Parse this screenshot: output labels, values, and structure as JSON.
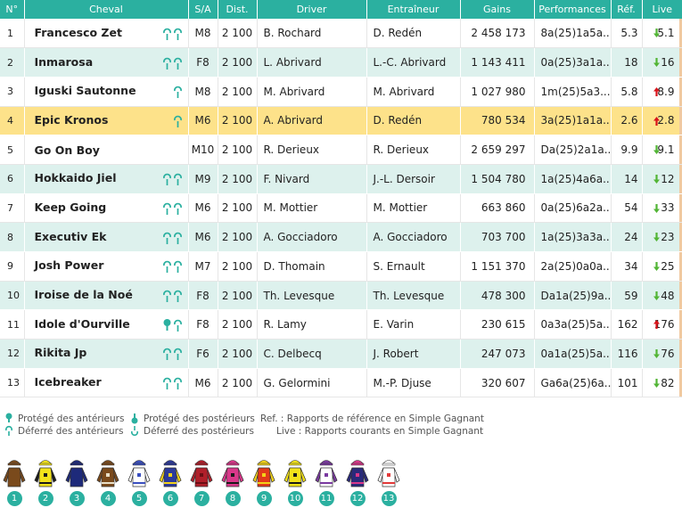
{
  "colors": {
    "accent": "#2bb0a0",
    "row_alt": "#ddf1ed",
    "row_selected": "#fde28a",
    "arrow_down": "#52b535",
    "arrow_up": "#d9131a"
  },
  "headers": {
    "num": "N°",
    "cheval": "Cheval",
    "sa": "S/A",
    "dist": "Dist.",
    "driver": "Driver",
    "entraineur": "Entraîneur",
    "gains": "Gains",
    "performances": "Performances",
    "ref": "Réf.",
    "live": "Live"
  },
  "rows": [
    {
      "num": "1",
      "cheval": "Francesco Zet",
      "shoes": [
        "deferre",
        "deferre"
      ],
      "sa": "M8",
      "dist": "2 100",
      "driver": "B. Rochard",
      "entraineur": "D. Redén",
      "gains": "2 458 173",
      "perf": "8a(25)1a5a...",
      "ref": "5.3",
      "live": "5.1",
      "trend": "down"
    },
    {
      "num": "2",
      "cheval": "Inmarosa",
      "shoes": [
        "deferre",
        "deferre"
      ],
      "sa": "F8",
      "dist": "2 100",
      "driver": "L. Abrivard",
      "entraineur": "L.-C. Abrivard",
      "gains": "1 143 411",
      "perf": "0a(25)3a1a...",
      "ref": "18",
      "live": "16",
      "trend": "down"
    },
    {
      "num": "3",
      "cheval": "Iguski Sautonne",
      "shoes": [
        "deferre"
      ],
      "sa": "M8",
      "dist": "2 100",
      "driver": "M. Abrivard",
      "entraineur": "M. Abrivard",
      "gains": "1 027 980",
      "perf": "1m(25)5a3...",
      "ref": "5.8",
      "live": "8.9",
      "trend": "up"
    },
    {
      "num": "4",
      "cheval": "Epic Kronos",
      "shoes": [
        "deferre"
      ],
      "sa": "M6",
      "dist": "2 100",
      "driver": "A. Abrivard",
      "entraineur": "D. Redén",
      "gains": "780 534",
      "perf": "3a(25)1a1a...",
      "ref": "2.6",
      "live": "2.8",
      "trend": "up"
    },
    {
      "num": "5",
      "cheval": "Go On Boy",
      "shoes": [],
      "sa": "M10",
      "dist": "2 100",
      "driver": "R. Derieux",
      "entraineur": "R. Derieux",
      "gains": "2 659 297",
      "perf": "Da(25)2a1a...",
      "ref": "9.9",
      "live": "9.1",
      "trend": "down"
    },
    {
      "num": "6",
      "cheval": "Hokkaido Jiel",
      "shoes": [
        "deferre",
        "deferre"
      ],
      "sa": "M9",
      "dist": "2 100",
      "driver": "F. Nivard",
      "entraineur": "J.-L. Dersoir",
      "gains": "1 504 780",
      "perf": "1a(25)4a6a...",
      "ref": "14",
      "live": "12",
      "trend": "down"
    },
    {
      "num": "7",
      "cheval": "Keep Going",
      "shoes": [
        "deferre",
        "deferre"
      ],
      "sa": "M6",
      "dist": "2 100",
      "driver": "M. Mottier",
      "entraineur": "M. Mottier",
      "gains": "663 860",
      "perf": "0a(25)6a2a...",
      "ref": "54",
      "live": "33",
      "trend": "down"
    },
    {
      "num": "8",
      "cheval": "Executiv Ek",
      "shoes": [
        "deferre",
        "deferre"
      ],
      "sa": "M6",
      "dist": "2 100",
      "driver": "A. Gocciadoro",
      "entraineur": "A. Gocciadoro",
      "gains": "703 700",
      "perf": "1a(25)3a3a...",
      "ref": "24",
      "live": "23",
      "trend": "down"
    },
    {
      "num": "9",
      "cheval": "Josh Power",
      "shoes": [
        "deferre",
        "deferre"
      ],
      "sa": "M7",
      "dist": "2 100",
      "driver": "D. Thomain",
      "entraineur": "S. Ernault",
      "gains": "1 151 370",
      "perf": "2a(25)0a0a...",
      "ref": "34",
      "live": "25",
      "trend": "down"
    },
    {
      "num": "10",
      "cheval": "Iroise de la Noé",
      "shoes": [
        "deferre",
        "deferre"
      ],
      "sa": "F8",
      "dist": "2 100",
      "driver": "Th. Levesque",
      "entraineur": "Th. Levesque",
      "gains": "478 300",
      "perf": "Da1a(25)9a...",
      "ref": "59",
      "live": "48",
      "trend": "down"
    },
    {
      "num": "11",
      "cheval": "Idole d'Ourville",
      "shoes": [
        "protege",
        "deferre"
      ],
      "sa": "F8",
      "dist": "2 100",
      "driver": "R. Lamy",
      "entraineur": "E. Varin",
      "gains": "230 615",
      "perf": "0a3a(25)5a...",
      "ref": "162",
      "live": "176",
      "trend": "up"
    },
    {
      "num": "12",
      "cheval": "Rikita Jp",
      "shoes": [
        "deferre",
        "deferre"
      ],
      "sa": "F6",
      "dist": "2 100",
      "driver": "C. Delbecq",
      "entraineur": "J. Robert",
      "gains": "247 073",
      "perf": "0a1a(25)5a...",
      "ref": "116",
      "live": "76",
      "trend": "down"
    },
    {
      "num": "13",
      "cheval": "Icebreaker",
      "shoes": [
        "deferre",
        "deferre"
      ],
      "sa": "M6",
      "dist": "2 100",
      "driver": "G. Gelormini",
      "entraineur": "M.-P. Djuse",
      "gains": "320 607",
      "perf": "Ga6a(25)6a...",
      "ref": "101",
      "live": "82",
      "trend": "down"
    }
  ],
  "legend": {
    "protege_ant": "Protégé des antérieurs",
    "deferre_ant": "Déferré des antérieurs",
    "protege_post": "Protégé des postérieurs",
    "deferre_post": "Déferré des postérieurs",
    "ref_note": "Ref. : Rapports de référence en Simple Gagnant",
    "live_note": "Live : Rapports courants en Simple Gagnant"
  },
  "casaques": [
    {
      "num": "1",
      "body": "#7a4a1c",
      "sleeve": "#7a4a1c",
      "cap": "#7a4a1c",
      "accent": "#7a4a1c"
    },
    {
      "num": "2",
      "body": "#f2e21a",
      "sleeve": "#1a1a1a",
      "cap": "#f2e21a",
      "accent": "#1a1a1a"
    },
    {
      "num": "3",
      "body": "#1e2a7a",
      "sleeve": "#1e2a7a",
      "cap": "#1e2a7a",
      "accent": "#1e2a7a"
    },
    {
      "num": "4",
      "body": "#7a4a1c",
      "sleeve": "#7a4a1c",
      "cap": "#7a4a1c",
      "accent": "#e9e0c8"
    },
    {
      "num": "5",
      "body": "#ffffff",
      "sleeve": "#ffffff",
      "cap": "#3a4fbf",
      "accent": "#3a4fbf"
    },
    {
      "num": "6",
      "body": "#2c3a9a",
      "sleeve": "#f2d21a",
      "cap": "#2c3a9a",
      "accent": "#f2d21a"
    },
    {
      "num": "7",
      "body": "#b01f2a",
      "sleeve": "#b01f2a",
      "cap": "#b01f2a",
      "accent": "#6a0f15"
    },
    {
      "num": "8",
      "body": "#d9388a",
      "sleeve": "#d9388a",
      "cap": "#d9388a",
      "accent": "#1a1a1a"
    },
    {
      "num": "9",
      "body": "#e23a1a",
      "sleeve": "#f2d21a",
      "cap": "#f2d21a",
      "accent": "#f2d21a"
    },
    {
      "num": "10",
      "body": "#f2e21a",
      "sleeve": "#f2e21a",
      "cap": "#f2e21a",
      "accent": "#1a1a1a"
    },
    {
      "num": "11",
      "body": "#ffffff",
      "sleeve": "#7a3aa0",
      "cap": "#7a3aa0",
      "accent": "#7a3aa0"
    },
    {
      "num": "12",
      "body": "#2a2a7a",
      "sleeve": "#2a2a7a",
      "cap": "#d9388a",
      "accent": "#d9388a"
    },
    {
      "num": "13",
      "body": "#ffffff",
      "sleeve": "#ffffff",
      "cap": "#ffffff",
      "accent": "#e23a3a"
    }
  ]
}
